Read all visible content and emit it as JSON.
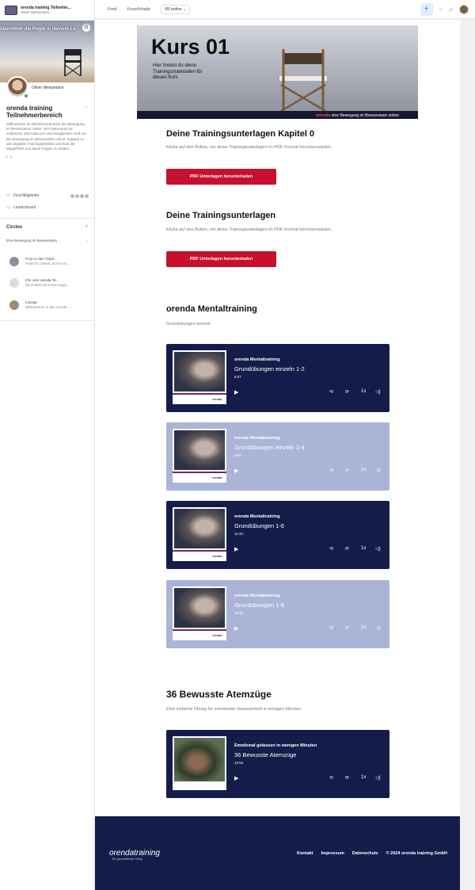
{
  "workspace": {
    "name": "orenda training Teilnehm...",
    "user": "Oliver Weissmann"
  },
  "sidebar": {
    "banner_text": "übernimm die Regie in deinem Le",
    "owner_name": "Oliver Weissmann",
    "community_title": "orenda training Teilnehmerbereich",
    "community_desc": "Willkommen im Teilnehmerbereich der Bewegung im Bewusstsein online. Hier bekommst du zahlreiche Informationen und Neuigkeiten rund um die Bewegung im Bewusstsein online, Zugang zu den digitalen Trainingsinhalten und hast die Möglichkeit uns deine Fragen zu stellen.",
    "social": [
      "f",
      "t"
    ],
    "members_label": "Find Mitglieder",
    "leaderboard_label": "Leaderboard",
    "circles_title": "Circles",
    "circle_dropdown": "Eine Bewegung im Bewusstsein ...",
    "channels": [
      {
        "title": "FAQ zu den Traini...",
        "sub": "Hallo ihr Lieben, durch ein ..."
      },
      {
        "title": "Info vom orenda Te...",
        "sub": "die E-Mail mit euren Zuga..."
      },
      {
        "title": "Lounge",
        "sub": "Willkommen in der orenda ..."
      }
    ]
  },
  "topbar": {
    "nav": [
      "Feed",
      "Kurse/Inhalte"
    ],
    "online": "0/0 online"
  },
  "hero": {
    "title": "Kurs 01",
    "subtitle": "Hier findest du deine Trainingsmaterialien für diesen Kurs",
    "brand_logo": "orenda",
    "brand_text": "eine Bewegung im Bewusstsein online"
  },
  "sections": {
    "s1": {
      "heading": "Deine Trainingsunterlagen Kapitel 0",
      "text": "Klicke auf den Button, um deine Trainingsunterlagen im PDF-Format herunterzuladen.",
      "button": "PDF Unterlagen herunterladen"
    },
    "s2": {
      "heading": "Deine Trainingsunterlagen",
      "text": "Klicke auf den Button, um deine Trainingsunterlagen im PDF-Format herunterzuladen.",
      "button": "PDF Unterlagen herunterladen"
    },
    "s3": {
      "heading": "orenda Mentaltraining",
      "text": "Grundübungen einzeln"
    },
    "s4": {
      "heading": "36 Bewusste Atemzüge",
      "text": "Eine einfache Übung für emotionale Gelassenheit in wenigen Minuten."
    }
  },
  "players": [
    {
      "sub": "orenda Mentaltraining",
      "title": "Grundübungen einzeln 1-2",
      "time": "6:07",
      "speed": "1x",
      "thumb_logo": "orenda"
    },
    {
      "sub": "orenda Mentaltraining",
      "title": "Grundübungen einzeln 1-4",
      "time": "9:55",
      "speed": "1x",
      "thumb_logo": "orenda"
    },
    {
      "sub": "orenda Mentaltraining",
      "title": "Grundübungen 1-6",
      "time": "11:43",
      "speed": "1x",
      "thumb_logo": "orenda"
    },
    {
      "sub": "orenda Mentaltraining",
      "title": "Grundübungen 1-9",
      "time": "15:00",
      "speed": "1x",
      "thumb_logo": "orenda"
    },
    {
      "sub": "Emotional gelassen in wenigen Minuten",
      "title": "36 Bewusste Atemzüge",
      "time": "12:53",
      "speed": "1x",
      "thumb_logo": ""
    }
  ],
  "footer": {
    "logo_a": "orenda",
    "logo_b": "training",
    "tagline": "Ein ganzheitlicher Erfolg",
    "links": [
      "Kontakt",
      "Impressum",
      "Datenschutz",
      "© 2024 orenda training GmbH"
    ]
  },
  "colors": {
    "navy": "#141c4a",
    "lavender": "#aab4d6",
    "red": "#c8102e"
  }
}
